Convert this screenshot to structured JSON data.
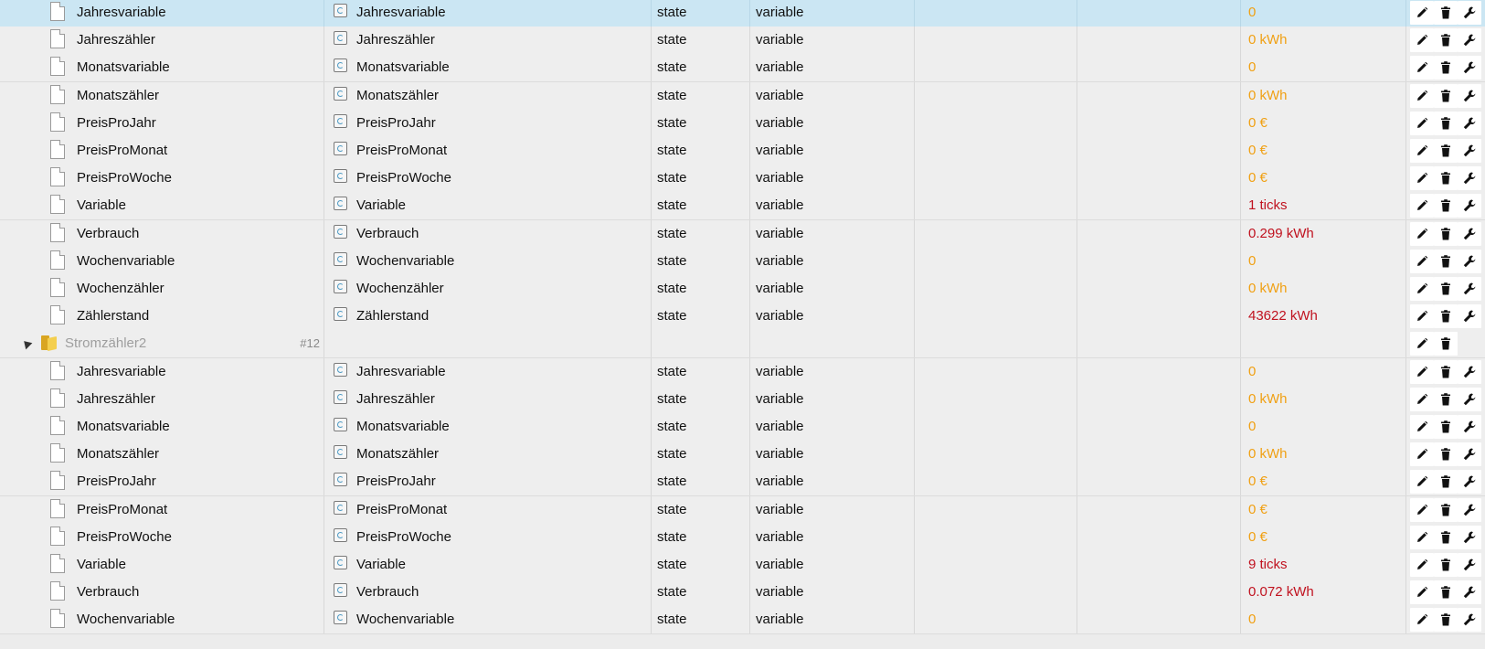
{
  "rows": [
    {
      "kind": "state",
      "name": "Jahresvariable",
      "role": "Jahresvariable",
      "type": "state",
      "role2": "variable",
      "value": "0",
      "value_color": "ack",
      "selected": true
    },
    {
      "kind": "state",
      "name": "Jahreszähler",
      "role": "Jahreszähler",
      "type": "state",
      "role2": "variable",
      "value": "0 kWh",
      "value_color": "ack"
    },
    {
      "kind": "state",
      "name": "Monatsvariable",
      "role": "Monatsvariable",
      "type": "state",
      "role2": "variable",
      "value": "0",
      "value_color": "ack"
    },
    {
      "kind": "state",
      "name": "Monatszähler",
      "role": "Monatszähler",
      "type": "state",
      "role2": "variable",
      "value": "0 kWh",
      "value_color": "ack"
    },
    {
      "kind": "state",
      "name": "PreisProJahr",
      "role": "PreisProJahr",
      "type": "state",
      "role2": "variable",
      "value": "0 €",
      "value_color": "ack"
    },
    {
      "kind": "state",
      "name": "PreisProMonat",
      "role": "PreisProMonat",
      "type": "state",
      "role2": "variable",
      "value": "0 €",
      "value_color": "ack"
    },
    {
      "kind": "state",
      "name": "PreisProWoche",
      "role": "PreisProWoche",
      "type": "state",
      "role2": "variable",
      "value": "0 €",
      "value_color": "ack"
    },
    {
      "kind": "state",
      "name": "Variable",
      "role": "Variable",
      "type": "state",
      "role2": "variable",
      "value": "1 ticks",
      "value_color": "nack"
    },
    {
      "kind": "state",
      "name": "Verbrauch",
      "role": "Verbrauch",
      "type": "state",
      "role2": "variable",
      "value": "0.299 kWh",
      "value_color": "nack"
    },
    {
      "kind": "state",
      "name": "Wochenvariable",
      "role": "Wochenvariable",
      "type": "state",
      "role2": "variable",
      "value": "0",
      "value_color": "ack"
    },
    {
      "kind": "state",
      "name": "Wochenzähler",
      "role": "Wochenzähler",
      "type": "state",
      "role2": "variable",
      "value": "0 kWh",
      "value_color": "ack"
    },
    {
      "kind": "state",
      "name": "Zählerstand",
      "role": "Zählerstand",
      "type": "state",
      "role2": "variable",
      "value": "43622 kWh",
      "value_color": "nack"
    },
    {
      "kind": "folder",
      "name": "Stromzähler2",
      "count": "#12"
    },
    {
      "kind": "state",
      "name": "Jahresvariable",
      "role": "Jahresvariable",
      "type": "state",
      "role2": "variable",
      "value": "0",
      "value_color": "ack"
    },
    {
      "kind": "state",
      "name": "Jahreszähler",
      "role": "Jahreszähler",
      "type": "state",
      "role2": "variable",
      "value": "0 kWh",
      "value_color": "ack"
    },
    {
      "kind": "state",
      "name": "Monatsvariable",
      "role": "Monatsvariable",
      "type": "state",
      "role2": "variable",
      "value": "0",
      "value_color": "ack"
    },
    {
      "kind": "state",
      "name": "Monatszähler",
      "role": "Monatszähler",
      "type": "state",
      "role2": "variable",
      "value": "0 kWh",
      "value_color": "ack"
    },
    {
      "kind": "state",
      "name": "PreisProJahr",
      "role": "PreisProJahr",
      "type": "state",
      "role2": "variable",
      "value": "0 €",
      "value_color": "ack"
    },
    {
      "kind": "state",
      "name": "PreisProMonat",
      "role": "PreisProMonat",
      "type": "state",
      "role2": "variable",
      "value": "0 €",
      "value_color": "ack"
    },
    {
      "kind": "state",
      "name": "PreisProWoche",
      "role": "PreisProWoche",
      "type": "state",
      "role2": "variable",
      "value": "0 €",
      "value_color": "ack"
    },
    {
      "kind": "state",
      "name": "Variable",
      "role": "Variable",
      "type": "state",
      "role2": "variable",
      "value": "9 ticks",
      "value_color": "nack"
    },
    {
      "kind": "state",
      "name": "Verbrauch",
      "role": "Verbrauch",
      "type": "state",
      "role2": "variable",
      "value": "0.072 kWh",
      "value_color": "nack"
    },
    {
      "kind": "state",
      "name": "Wochenvariable",
      "role": "Wochenvariable",
      "type": "state",
      "role2": "variable",
      "value": "0",
      "value_color": "ack"
    }
  ],
  "colors": {
    "ack": "#f0a013",
    "nack": "#c0121f",
    "selected_row": "#cbe6f3"
  },
  "icons": {
    "state": "document-icon",
    "role": "state-role-icon",
    "folder": "folder-icon",
    "expander": "expanded-triangle-icon",
    "edit": "pencil-icon",
    "delete": "trash-icon",
    "custom": "wrench-icon"
  }
}
